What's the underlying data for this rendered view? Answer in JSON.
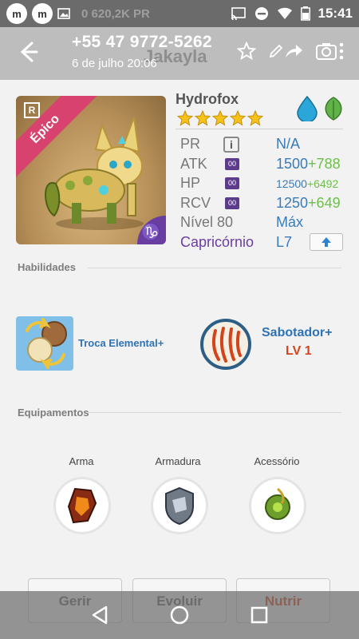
{
  "status_bar": {
    "ghost_text": "0  620,2K PR",
    "time": "15:41"
  },
  "header": {
    "phone": "+55 47 9772-5262",
    "datetime": "6 de julho 20:06",
    "ghost_title": "Jakayla"
  },
  "monster": {
    "name": "Hydrofox",
    "rarity": "Épico",
    "stars": 5,
    "elements": [
      "water",
      "nature"
    ],
    "sign_glyph": "♑"
  },
  "stats": {
    "pr": {
      "label": "PR",
      "value": "N/A"
    },
    "atk": {
      "label": "ATK",
      "tag": "00",
      "base": "1500",
      "bonus": "+788"
    },
    "hp": {
      "label": "HP",
      "tag": "00",
      "base": "12500",
      "bonus": "+6492"
    },
    "rcv": {
      "label": "RCV",
      "tag": "00",
      "base": "1250",
      "bonus": "+649"
    },
    "level": {
      "label": "Nível 80",
      "value": "Máx"
    },
    "sign": {
      "label": "Capricórnio",
      "value": "L7"
    }
  },
  "skills": {
    "title": "Habilidades",
    "skill1": {
      "name": "Troca Elemental+"
    },
    "skill2": {
      "name": "Sabotador+",
      "level": "LV 1"
    }
  },
  "equipment": {
    "title": "Equipamentos",
    "slots": [
      {
        "label": "Arma"
      },
      {
        "label": "Armadura"
      },
      {
        "label": "Acessório"
      }
    ]
  },
  "actions": {
    "manage": "Gerir",
    "evolve": "Evoluir",
    "feed": "Nutrir"
  },
  "colors": {
    "accent_blue": "#3a7bb8",
    "bonus_green": "#6cc04a",
    "epic_pink": "#d7436e",
    "orange": "#d2451c"
  }
}
